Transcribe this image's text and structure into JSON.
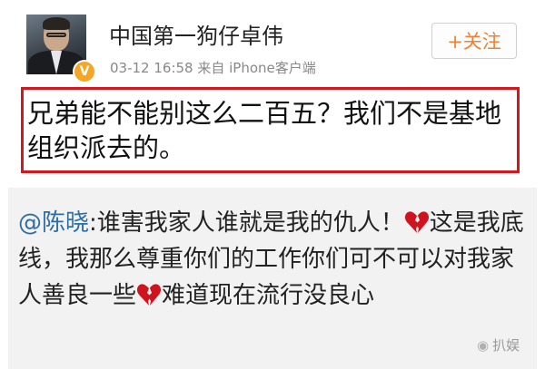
{
  "header": {
    "username": "中国第一狗仔卓伟",
    "date": "03-12 16:58",
    "source": "来自 iPhone客户端",
    "follow_label": "+关注",
    "avatar_icon": "person-avatar",
    "verified_badge": "V",
    "verified_color": "#f6a623"
  },
  "post": {
    "text": "兄弟能不能别这么二百五？我们不是基地组织派去的。",
    "highlight_color": "#d4171d"
  },
  "repost": {
    "mention": "@陈晓",
    "part1": ":谁害我家人谁就是我的仇人！",
    "part2": "这是我底线，我那么尊重你们的工作你们可不可以对我家人善良一些",
    "part3": "难道现在流行没良心",
    "emoji_icon": "broken-heart-icon"
  },
  "watermark": {
    "icon": "wechat-icon",
    "text": "扒娱"
  }
}
